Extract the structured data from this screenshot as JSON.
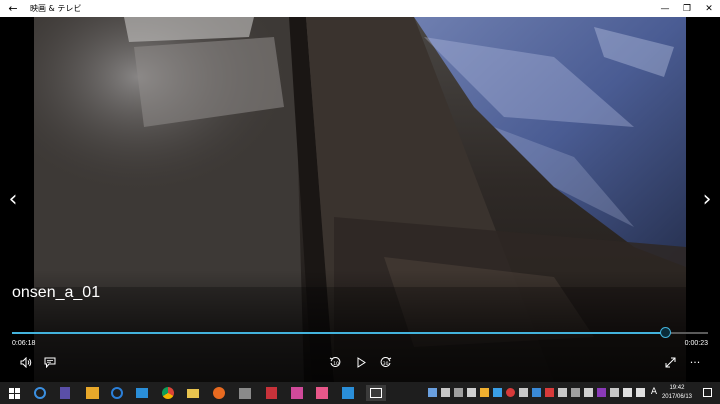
{
  "window": {
    "back_glyph": "←",
    "title": "映画 & テレビ",
    "minimize_glyph": "—",
    "maximize_glyph": "❐",
    "close_glyph": "✕"
  },
  "player": {
    "video_title": "onsen_a_01",
    "elapsed": "0:06:18",
    "remaining": "0:00:23",
    "progress": 0.94,
    "prev_glyph": "‹",
    "next_glyph": "›",
    "more_glyph": "···"
  },
  "taskbar": {
    "ime_indicator": "A",
    "time": "19:42",
    "date": "2017/06/13"
  },
  "colors": {
    "accent": "#43b3dc",
    "taskbar": "#1e1e1e"
  }
}
